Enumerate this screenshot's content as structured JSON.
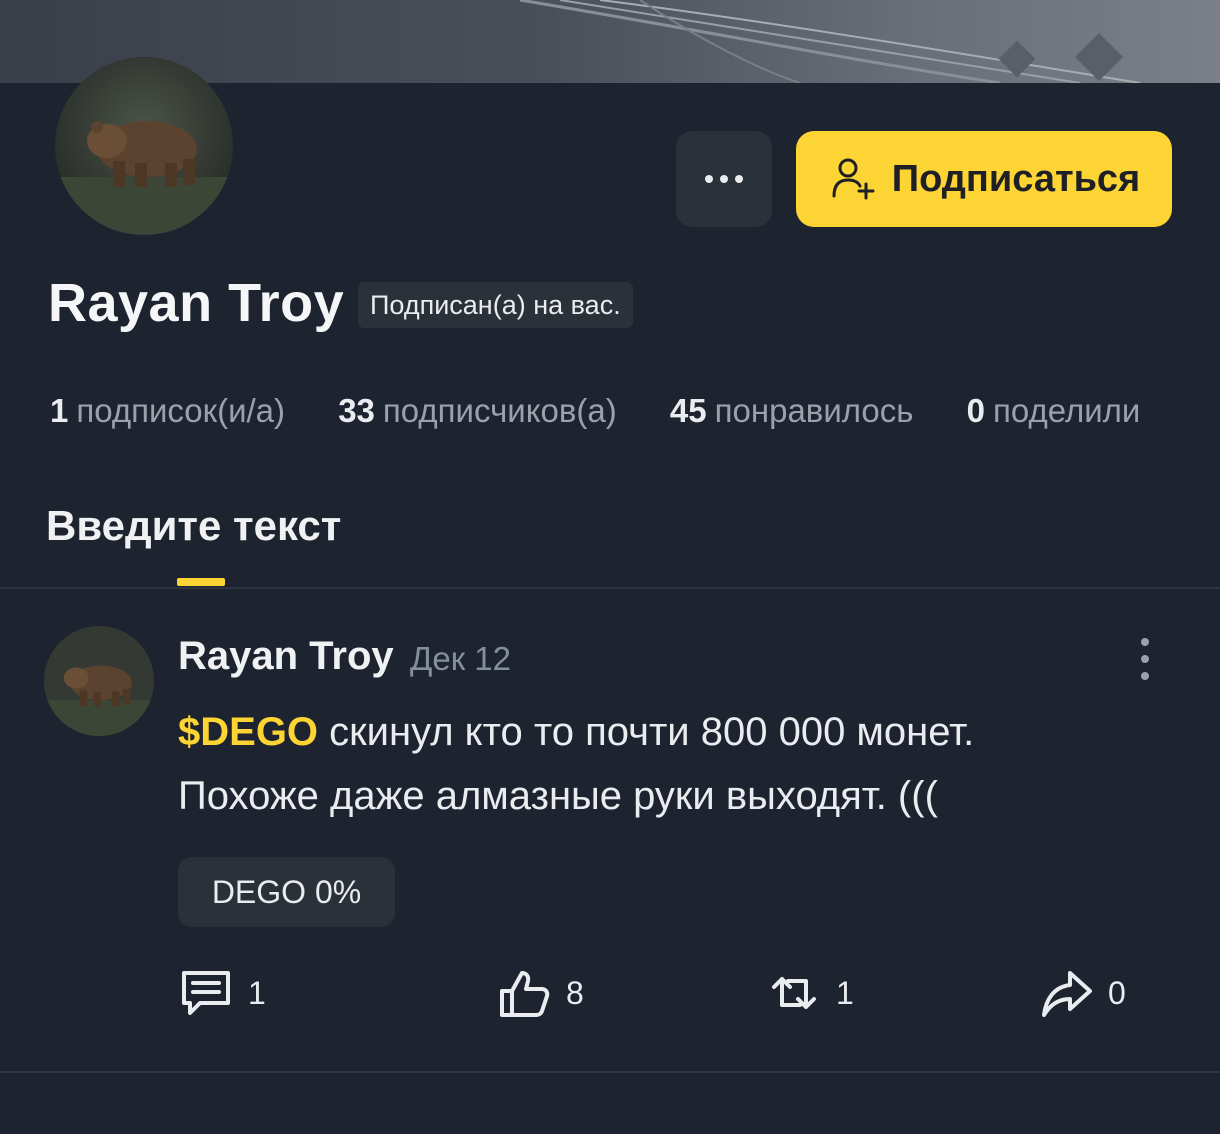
{
  "profile": {
    "name": "Rayan Troy",
    "follows_you_badge": "Подписан(а) на вас.",
    "avatar_alt": "bear-photo"
  },
  "actions": {
    "more_icon": "ellipsis-icon",
    "follow_label": "Подписаться",
    "follow_icon": "add-user-icon",
    "accent_color": "#fcd535"
  },
  "stats": [
    {
      "count": "1",
      "label": "подписок(и/а)"
    },
    {
      "count": "33",
      "label": "подписчиков(а)"
    },
    {
      "count": "45",
      "label": "понравилось"
    },
    {
      "count": "0",
      "label": "поделили"
    }
  ],
  "tab": {
    "label": "Введите текст"
  },
  "post": {
    "author": "Rayan Troy",
    "date": "Дек 12",
    "cashtag": "$DEGO",
    "text_line1": " скинул кто то почти 800 000 монет.",
    "text_line2": "Похоже даже алмазные руки выходят. (((",
    "coin_chip": "DEGO 0%",
    "comments": "1",
    "likes": "8",
    "reposts": "1",
    "shares": "0"
  }
}
